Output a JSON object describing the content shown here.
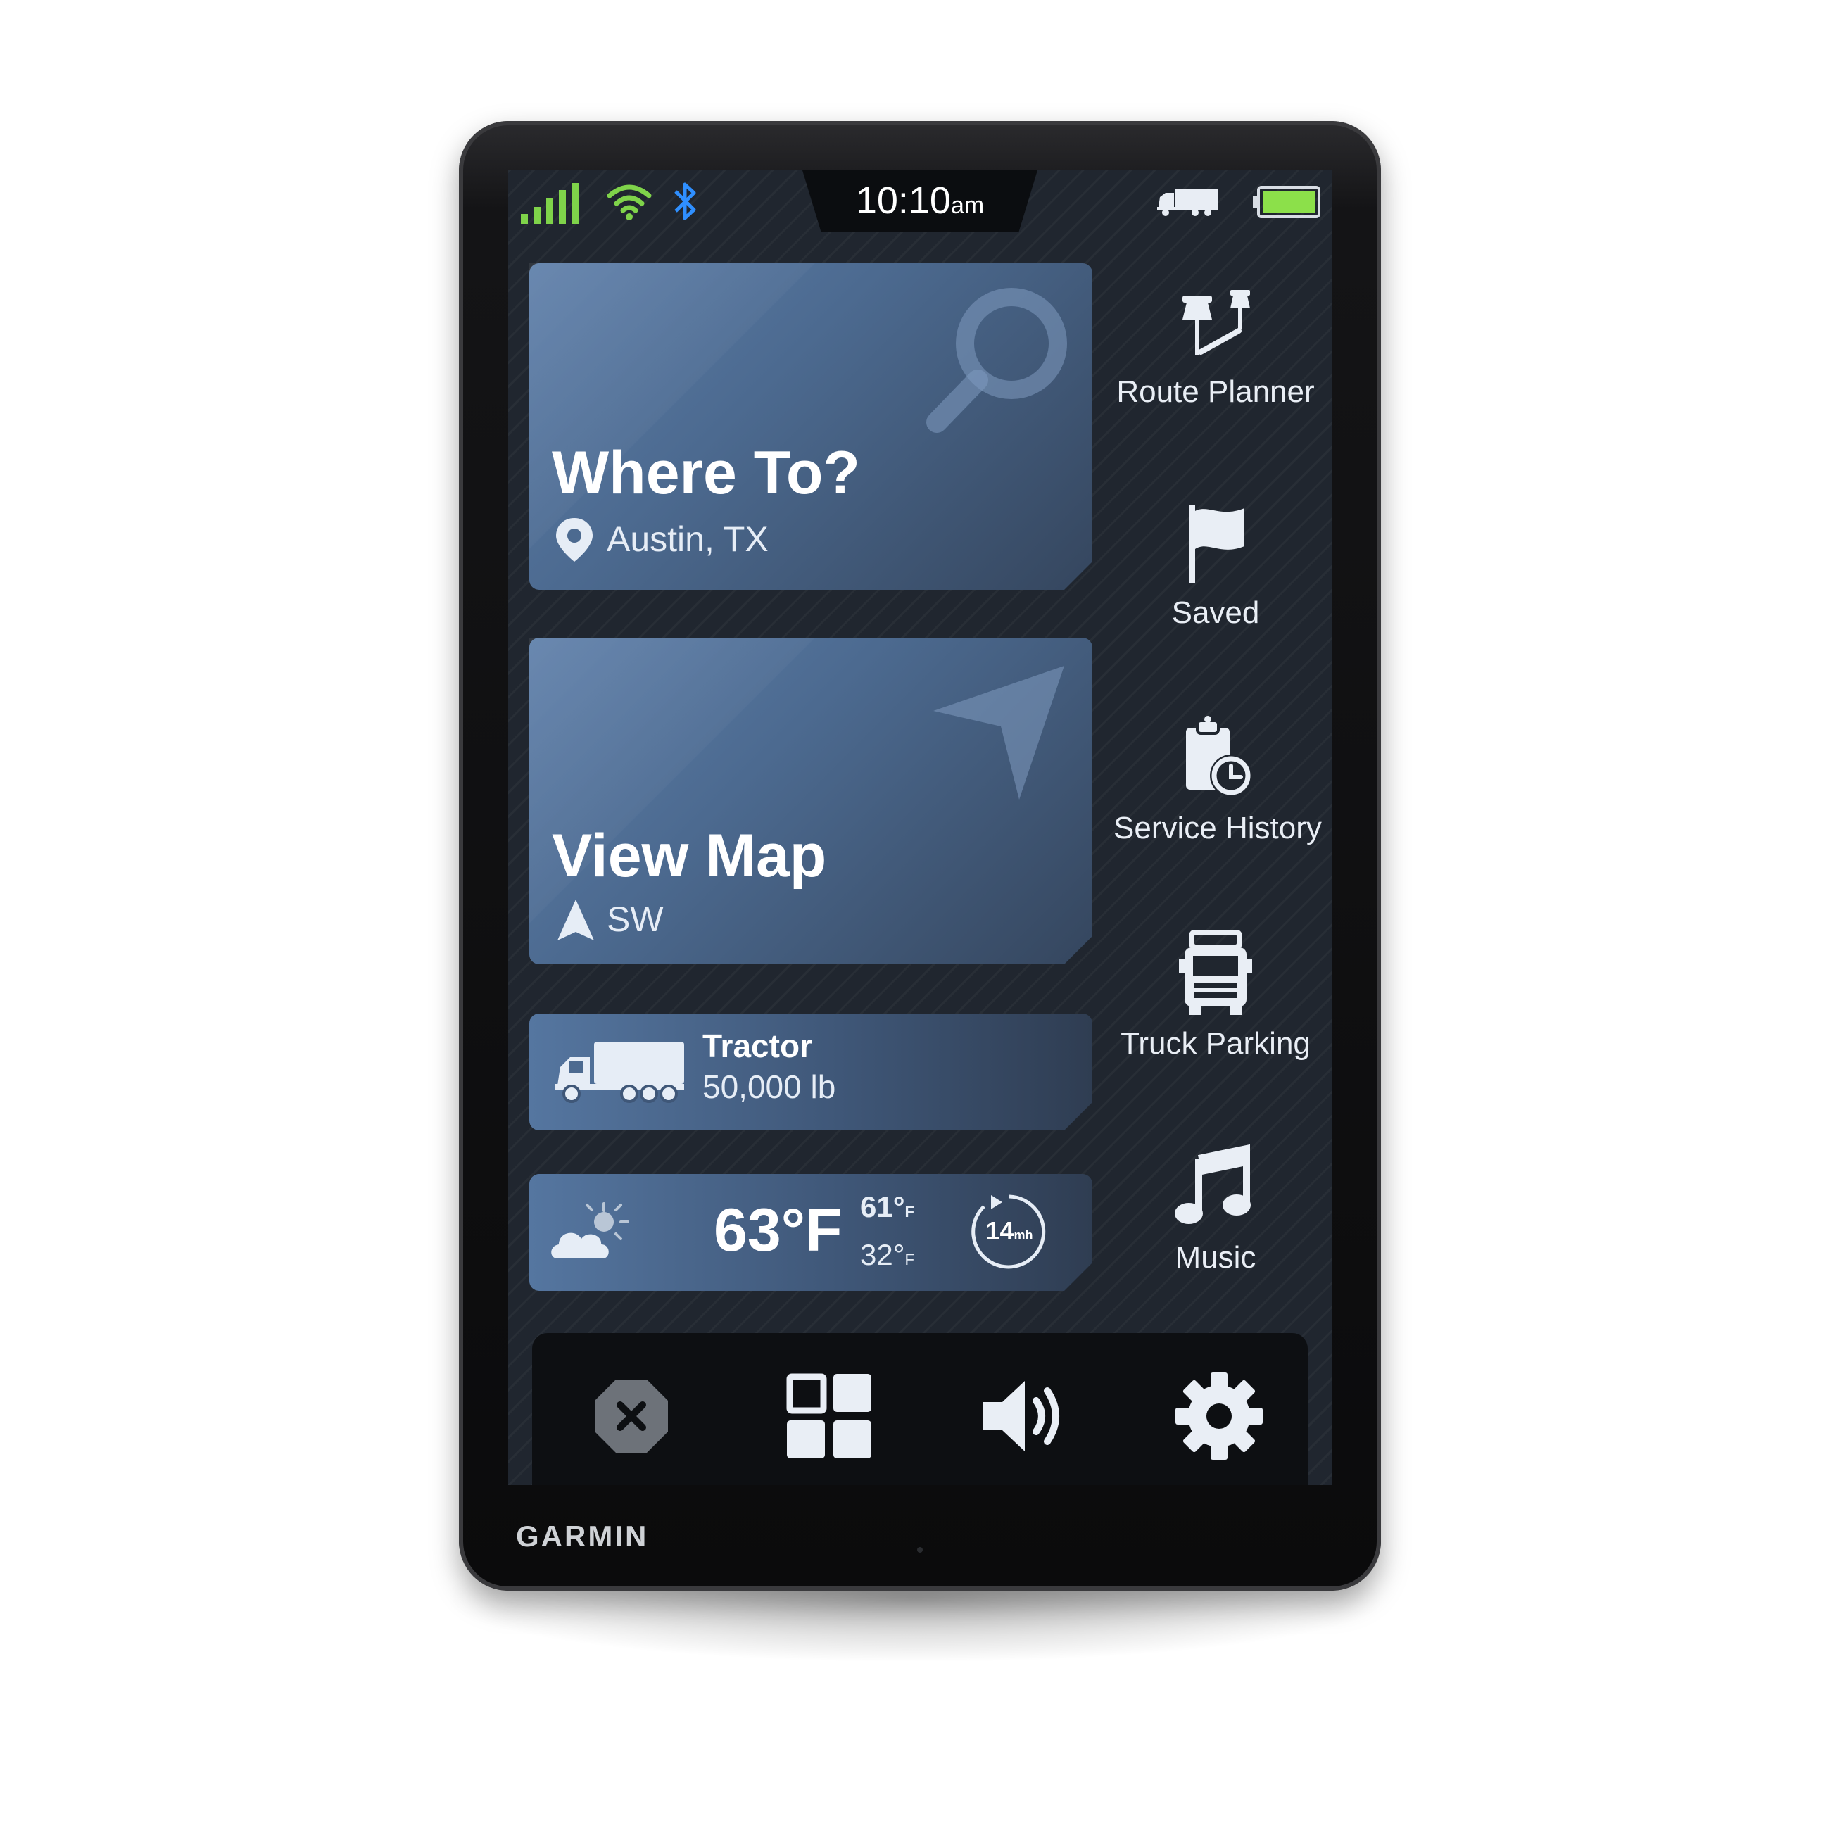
{
  "status_bar": {
    "time": "10:10",
    "time_suffix": "am",
    "icons": [
      "cellular-signal-icon",
      "wifi-icon",
      "bluetooth-icon",
      "truck-mode-icon",
      "battery-icon"
    ],
    "signal_color": "#7fd34a",
    "bluetooth_color": "#2f8fff",
    "battery_color": "#8ce04a"
  },
  "cards": {
    "where_to": {
      "title": "Where To?",
      "location": "Austin, TX",
      "icons": [
        "search-icon",
        "location-pin-icon"
      ]
    },
    "view_map": {
      "title": "View Map",
      "heading": "SW",
      "icons": [
        "navigation-arrow-icon",
        "heading-arrow-icon"
      ]
    },
    "vehicle": {
      "name": "Tractor",
      "weight": "50,000 lb",
      "icons": [
        "truck-icon"
      ]
    },
    "weather": {
      "current_temp": "63°F",
      "high": "61°",
      "high_unit": "F",
      "low": "32°",
      "low_unit": "F",
      "wind_value": "14",
      "wind_unit": "mh",
      "icons": [
        "partly-cloudy-icon",
        "wind-speed-icon"
      ]
    }
  },
  "side_menu": [
    {
      "label": "Route Planner",
      "icon": "route-planner-icon"
    },
    {
      "label": "Saved",
      "icon": "flag-icon"
    },
    {
      "label": "Service History",
      "icon": "service-history-icon"
    },
    {
      "label": "Truck Parking",
      "icon": "truck-parking-icon"
    },
    {
      "label": "Music",
      "icon": "music-note-icon"
    }
  ],
  "bottom_bar": [
    "stop-icon",
    "apps-grid-icon",
    "volume-icon",
    "settings-gear-icon"
  ],
  "brand": "GARMIN",
  "colors": {
    "screen_bg": "#20262f",
    "card_blue": "#4c6a90",
    "text": "#ffffff"
  }
}
